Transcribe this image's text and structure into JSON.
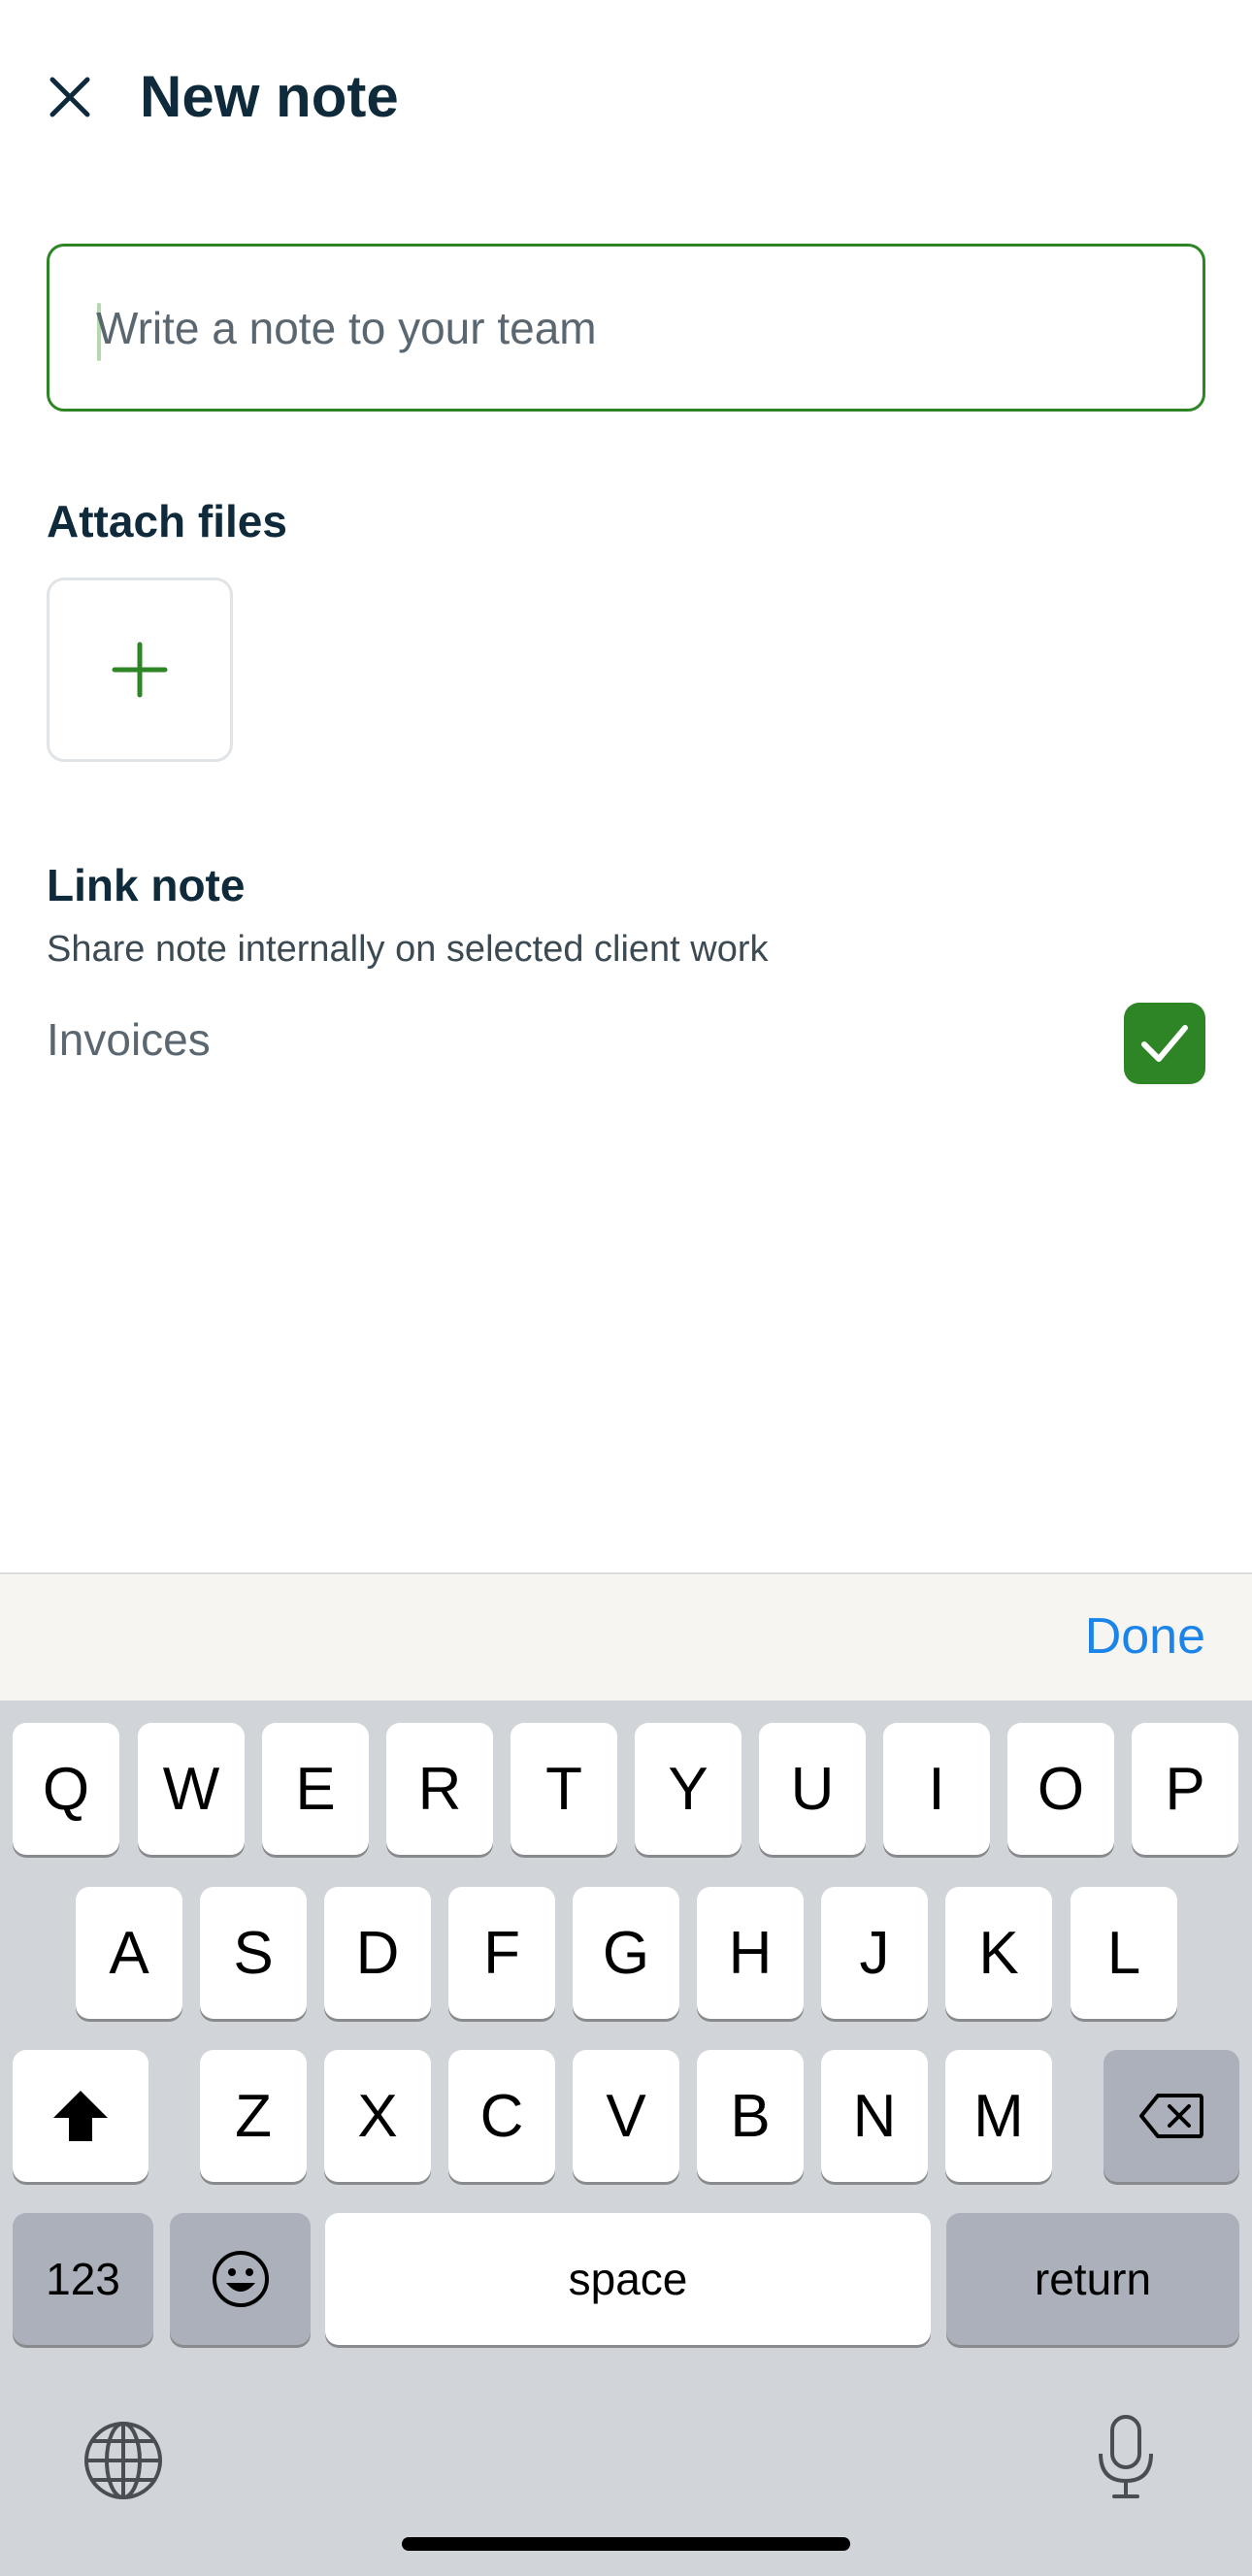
{
  "header": {
    "title": "New note",
    "close_icon": "close-icon"
  },
  "note": {
    "placeholder": "Write a note to your team",
    "value": ""
  },
  "attach": {
    "heading": "Attach files",
    "add_icon": "plus-icon"
  },
  "link": {
    "heading": "Link note",
    "description": "Share note internally on selected client work",
    "items": [
      {
        "label": "Invoices",
        "checked": true
      }
    ]
  },
  "accessory": {
    "done_label": "Done"
  },
  "keyboard": {
    "row1": [
      "Q",
      "W",
      "E",
      "R",
      "T",
      "Y",
      "U",
      "I",
      "O",
      "P"
    ],
    "row2": [
      "A",
      "S",
      "D",
      "F",
      "G",
      "H",
      "J",
      "K",
      "L"
    ],
    "row3": [
      "Z",
      "X",
      "C",
      "V",
      "B",
      "N",
      "M"
    ],
    "numbers_label": "123",
    "space_label": "space",
    "return_label": "return"
  },
  "colors": {
    "accent_green": "#2e8525",
    "link_blue": "#1a84e8",
    "title_navy": "#0f2a3a"
  }
}
